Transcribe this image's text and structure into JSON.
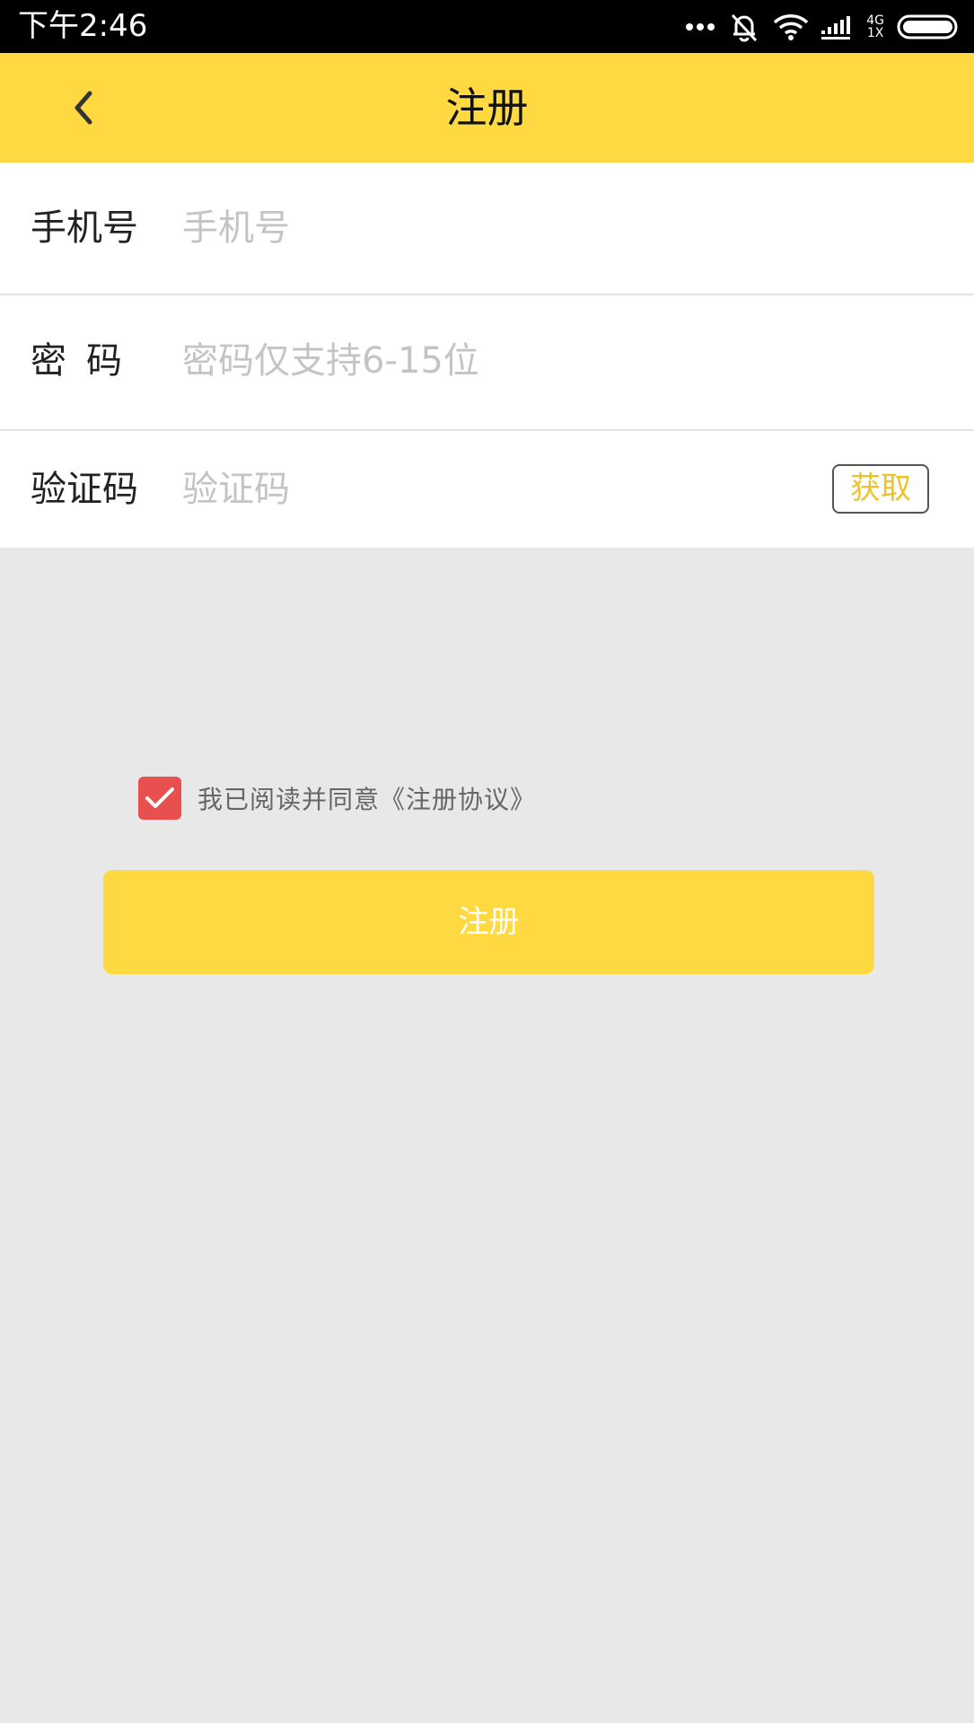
{
  "status_bar": {
    "time": "下午2:46",
    "network_top": "4G",
    "network_bottom": "1X",
    "icons": [
      "more-dots-icon",
      "mute-bell-icon",
      "wifi-icon",
      "signal-icon",
      "battery-icon"
    ]
  },
  "header": {
    "title": "注册",
    "back_icon": "chevron-left-icon",
    "background": "#fed941"
  },
  "form": {
    "phone": {
      "label": "手机号",
      "placeholder": "手机号",
      "value": ""
    },
    "password": {
      "label": "密码",
      "placeholder": "密码仅支持6-15位",
      "value": ""
    },
    "code": {
      "label": "验证码",
      "placeholder": "验证码",
      "value": "",
      "get_button": "获取"
    }
  },
  "agreement": {
    "checked": true,
    "text": "我已阅读并同意《注册协议》",
    "checkbox_color": "#e84f4f"
  },
  "submit": {
    "label": "注册",
    "color": "#fed941"
  }
}
